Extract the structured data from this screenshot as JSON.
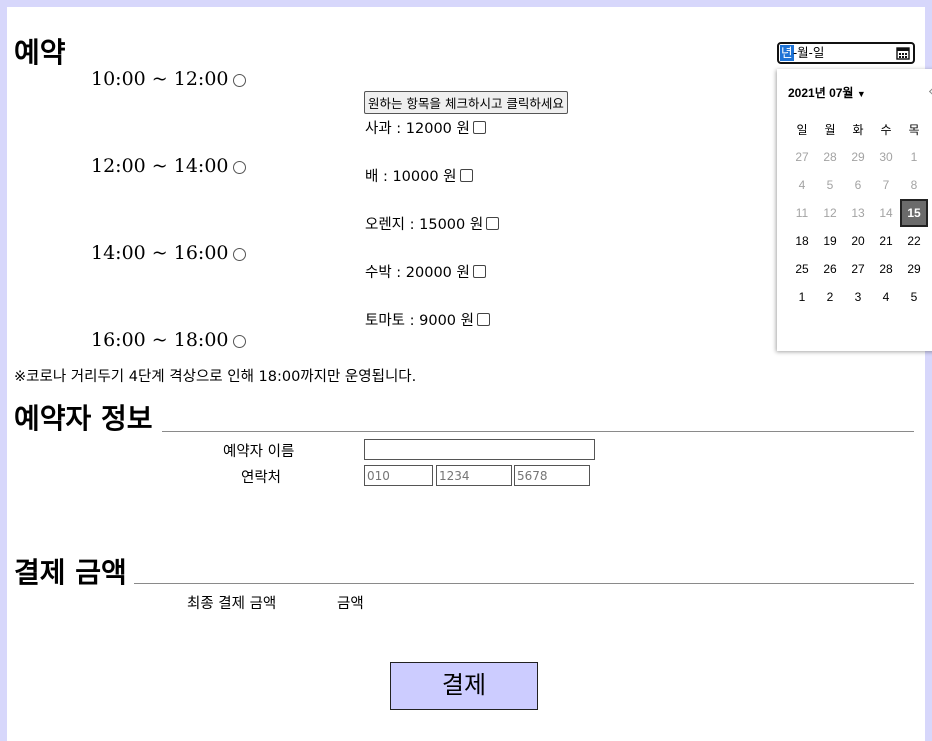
{
  "reservation": {
    "title": "예약",
    "time_slots": [
      "10:00 ~ 12:00",
      "12:00 ~ 14:00",
      "14:00 ~ 16:00",
      "16:00 ~ 18:00"
    ],
    "notice": "※코로나 거리두기 4단계 격상으로 인해 18:00까지만 운영됩니다."
  },
  "products": {
    "button_label": "원하는 항목을 체크하시고 클릭하세요",
    "items": [
      "사과 : 12000 원",
      "배 : 10000 원",
      "오렌지 : 15000 원",
      "수박 : 20000 원",
      "토마토 : 9000 원"
    ]
  },
  "date_input": {
    "year_placeholder": "년",
    "rest_placeholder": "-월-일",
    "calendar_icon": "calendar-icon"
  },
  "calendar": {
    "month_label": "2021년 07월",
    "dropdown_icon": "caret-down-icon",
    "weekdays": [
      "일",
      "월",
      "화",
      "수",
      "목"
    ],
    "rows": [
      [
        {
          "d": "27",
          "o": true
        },
        {
          "d": "28",
          "o": true
        },
        {
          "d": "29",
          "o": true
        },
        {
          "d": "30",
          "o": true
        },
        {
          "d": "1",
          "o": true
        }
      ],
      [
        {
          "d": "4",
          "o": true
        },
        {
          "d": "5",
          "o": true
        },
        {
          "d": "6",
          "o": true
        },
        {
          "d": "7",
          "o": true
        },
        {
          "d": "8",
          "o": true
        }
      ],
      [
        {
          "d": "11",
          "o": true
        },
        {
          "d": "12",
          "o": true
        },
        {
          "d": "13",
          "o": true
        },
        {
          "d": "14",
          "o": true
        },
        {
          "d": "15",
          "o": false,
          "today": true
        }
      ],
      [
        {
          "d": "18",
          "o": false
        },
        {
          "d": "19",
          "o": false
        },
        {
          "d": "20",
          "o": false
        },
        {
          "d": "21",
          "o": false
        },
        {
          "d": "22",
          "o": false
        }
      ],
      [
        {
          "d": "25",
          "o": false
        },
        {
          "d": "26",
          "o": false
        },
        {
          "d": "27",
          "o": false
        },
        {
          "d": "28",
          "o": false
        },
        {
          "d": "29",
          "o": false
        }
      ],
      [
        {
          "d": "1",
          "o": false
        },
        {
          "d": "2",
          "o": false
        },
        {
          "d": "3",
          "o": false
        },
        {
          "d": "4",
          "o": false
        },
        {
          "d": "5",
          "o": false
        }
      ]
    ]
  },
  "booker": {
    "title": "예약자 정보",
    "name_label": "예약자 이름",
    "name_value": "",
    "phone_label": "연락처",
    "phone_placeholders": [
      "010",
      "1234",
      "5678"
    ]
  },
  "payment": {
    "title": "결제 금액",
    "final_label": "최종 결제 금액",
    "amount_label": "금액",
    "pay_button": "결제"
  },
  "colors": {
    "page_background": "#d7d7fb",
    "pay_button": "#ccccff",
    "today_highlight": "#6b6b6b",
    "year_highlight": "#1e73d6"
  }
}
